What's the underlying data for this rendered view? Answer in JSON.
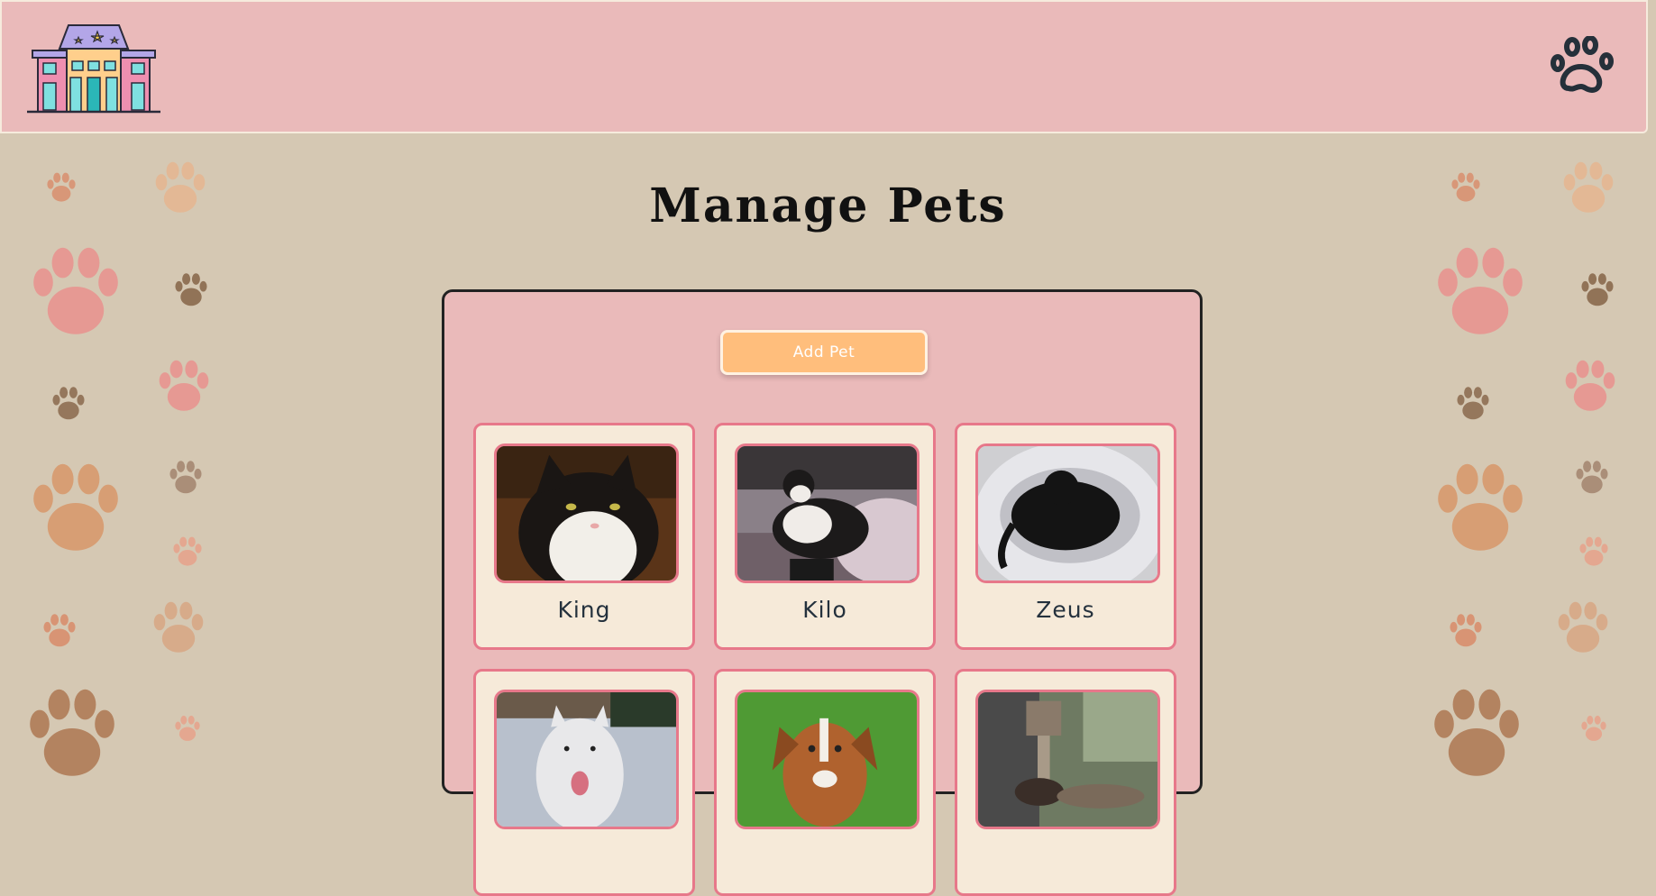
{
  "header": {
    "logo_icon": "hotel-building-icon",
    "nav_icon": "paw-icon"
  },
  "page": {
    "title": "Manage Pets"
  },
  "panel": {
    "add_button_label": "Add Pet",
    "pets": [
      {
        "name": "King"
      },
      {
        "name": "Kilo"
      },
      {
        "name": "Zeus"
      },
      {
        "name": ""
      },
      {
        "name": ""
      },
      {
        "name": ""
      }
    ]
  },
  "colors": {
    "background": "#d5c8b3",
    "header": "#eababa",
    "panel": "#eababa",
    "card": "#f6ead9",
    "card_border": "#e7788a",
    "button": "#ffbe7c"
  }
}
